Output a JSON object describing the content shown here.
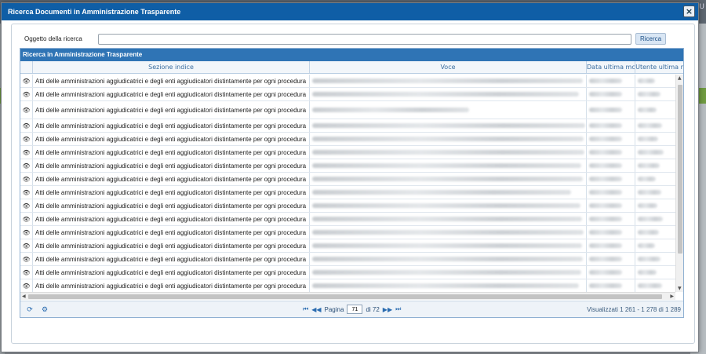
{
  "background": {
    "corner_text": "U"
  },
  "modal": {
    "title": "Ricerca Documenti in Amministrazione Trasparente",
    "close_label": "×"
  },
  "search": {
    "label": "Oggetto della ricerca",
    "value": "",
    "button_label": "Ricerca"
  },
  "grid": {
    "title": "Ricerca in Amministrazione Trasparente",
    "columns": [
      "",
      "Sezione indice",
      "Voce",
      "Data ultima mc",
      "Utente ultima r"
    ],
    "row_section_text": "Atti delle amministrazioni aggiudicatrici e degli enti aggiudicatori distintamente per ogni procedura",
    "row_count_visible": 16,
    "row_icon": "eye-icon"
  },
  "pager": {
    "refresh_icon": "refresh-icon",
    "settings_icon": "gear-icon",
    "first_label": "⏮",
    "prev_label": "◀◀",
    "page_label": "Pagina",
    "page_value": "71",
    "of_label": "di 72",
    "next_label": "▶▶",
    "last_label": "⏭",
    "info": "Visualizzati 1 261 - 1 278 di 1 289"
  },
  "colors": {
    "header_blue": "#0f5ea6",
    "grid_title_blue": "#2f74b5"
  }
}
